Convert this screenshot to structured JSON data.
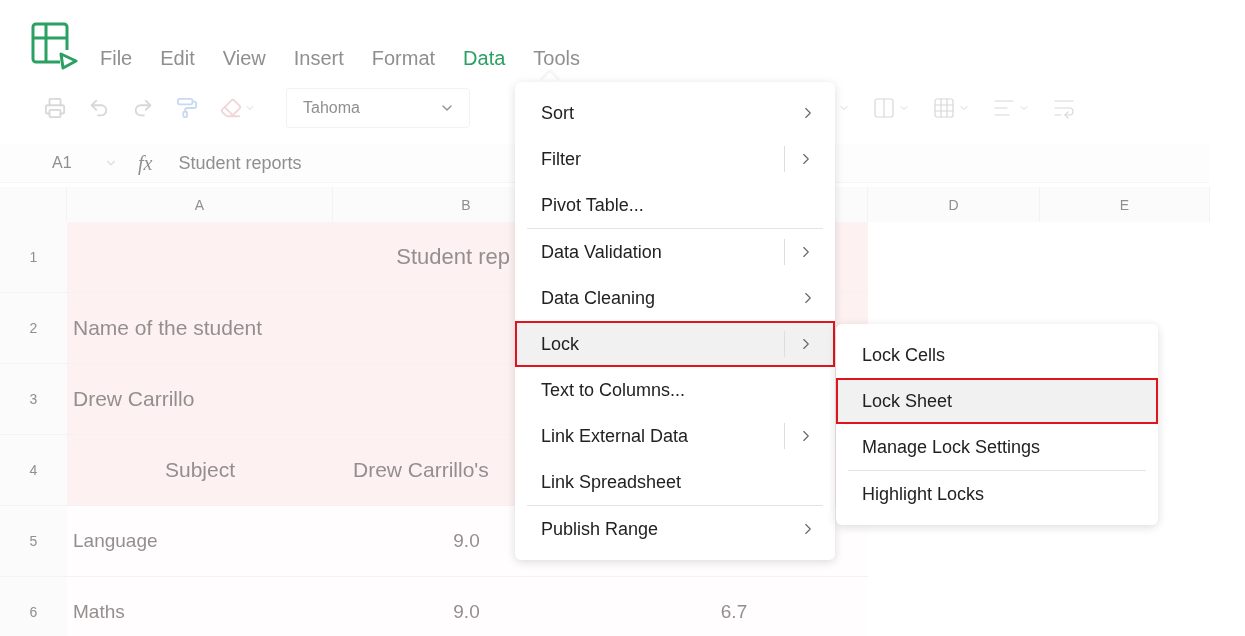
{
  "menu_bar": [
    {
      "label": "File",
      "selected": false
    },
    {
      "label": "Edit",
      "selected": false
    },
    {
      "label": "View",
      "selected": false
    },
    {
      "label": "Insert",
      "selected": false
    },
    {
      "label": "Format",
      "selected": false
    },
    {
      "label": "Data",
      "selected": true
    },
    {
      "label": "Tools",
      "selected": false
    }
  ],
  "toolbar": {
    "font": "Tahoma"
  },
  "formula_bar": {
    "cell_ref": "A1",
    "function_label": "fx",
    "formula": "Student reports"
  },
  "columns": [
    {
      "label": "A"
    },
    {
      "label": "B"
    },
    {},
    {
      "label": "D"
    },
    {
      "label": "E"
    }
  ],
  "rows": [
    {
      "number": "1",
      "kind": "title",
      "cells": [
        "Student rep"
      ]
    },
    {
      "number": "2",
      "kind": "text",
      "cells": [
        "Name of the student"
      ]
    },
    {
      "number": "3",
      "kind": "text",
      "cells": [
        "Drew Carrillo"
      ]
    },
    {
      "number": "4",
      "kind": "header",
      "cells": [
        "Subject",
        "Drew Carrillo's"
      ]
    },
    {
      "number": "5",
      "kind": "values",
      "cells": [
        "Language",
        "9.0"
      ]
    },
    {
      "number": "6",
      "kind": "values",
      "cells": [
        "Maths",
        "9.0",
        "6.7"
      ]
    }
  ],
  "data_menu": {
    "groups": [
      [
        {
          "label": "Sort",
          "kind": "submenu",
          "selected": false
        },
        {
          "label": "Filter",
          "kind": "split",
          "selected": false
        },
        {
          "label": "Pivot Table...",
          "kind": "plain",
          "selected": false
        }
      ],
      [
        {
          "label": "Data Validation",
          "kind": "split",
          "selected": false
        },
        {
          "label": "Data Cleaning",
          "kind": "submenu",
          "selected": false
        },
        {
          "label": "Lock",
          "kind": "split",
          "selected": true
        },
        {
          "label": "Text to Columns...",
          "kind": "plain",
          "selected": false
        },
        {
          "label": "Link External Data",
          "kind": "split",
          "selected": false
        },
        {
          "label": "Link Spreadsheet",
          "kind": "plain",
          "selected": false
        }
      ],
      [
        {
          "label": "Publish Range",
          "kind": "submenu",
          "selected": false
        }
      ]
    ]
  },
  "lock_submenu": {
    "groups": [
      [
        {
          "label": "Lock Cells",
          "selected": false
        },
        {
          "label": "Lock Sheet",
          "selected": true
        },
        {
          "label": "Manage Lock Settings",
          "selected": false
        }
      ],
      [
        {
          "label": "Highlight Locks",
          "selected": false
        }
      ]
    ]
  }
}
